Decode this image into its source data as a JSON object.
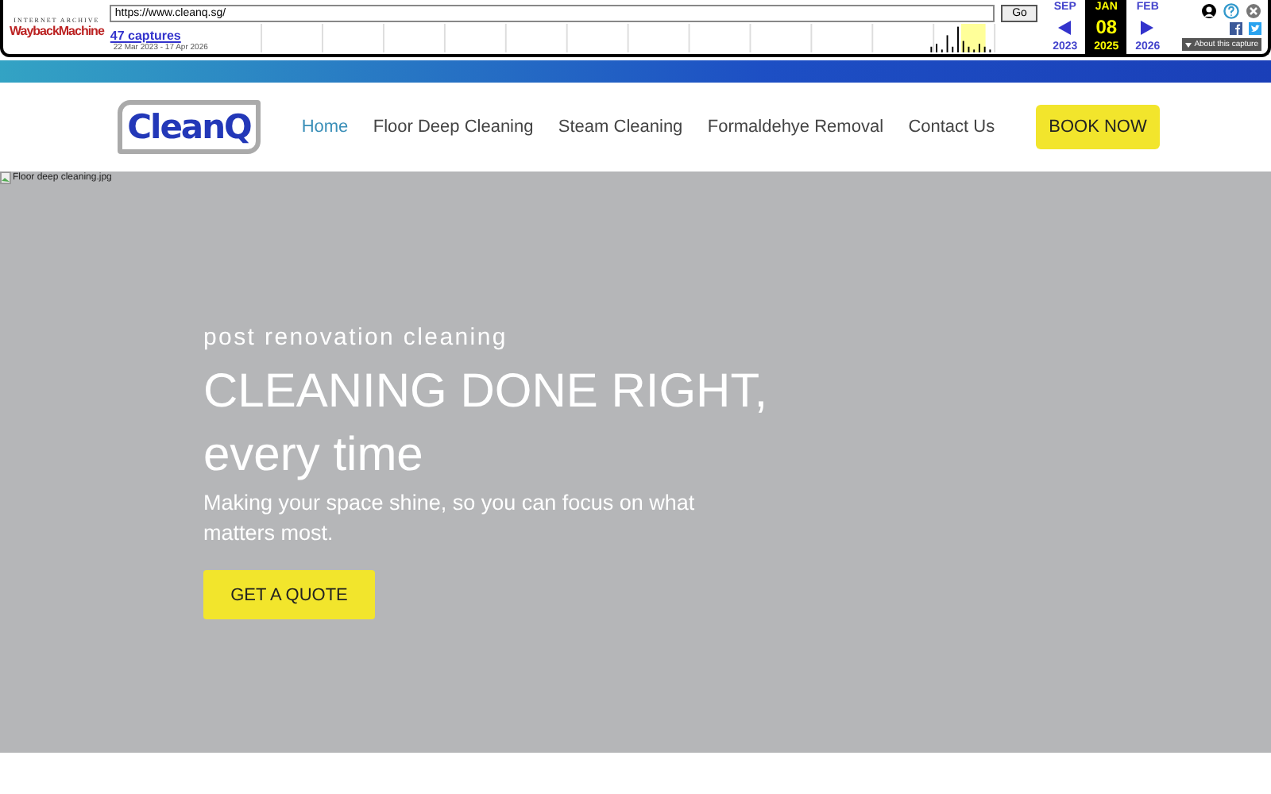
{
  "wayback": {
    "logo_top": "INTERNET ARCHIVE",
    "logo": "WaybackMachine",
    "url": "https://www.cleanq.sg/",
    "go": "Go",
    "captures": "47 captures",
    "range": "22 Mar 2023 - 17 Apr 2026",
    "months": [
      {
        "month": "SEP",
        "year": "2023",
        "selected": false
      },
      {
        "month": "JAN",
        "day": "08",
        "year": "2025",
        "selected": true
      },
      {
        "month": "FEB",
        "year": "2026",
        "selected": false
      }
    ],
    "about": "About this capture"
  },
  "nav": {
    "logo": "CleanQ",
    "items": [
      {
        "label": "Home",
        "selected": true
      },
      {
        "label": "Floor Deep Cleaning",
        "selected": false
      },
      {
        "label": "Steam Cleaning",
        "selected": false
      },
      {
        "label": "Formaldehye Removal",
        "selected": false
      },
      {
        "label": "Contact Us",
        "selected": false
      }
    ],
    "cta": "BOOK NOW"
  },
  "hero": {
    "image_alt": "Floor deep cleaning.jpg",
    "eyebrow": "post renovation cleaning",
    "title_line1": "CLEANING DONE RIGHT,",
    "title_line2": "every time",
    "subtitle": "Making your space shine, so you can focus on what matters most.",
    "cta": "GET A QUOTE"
  }
}
